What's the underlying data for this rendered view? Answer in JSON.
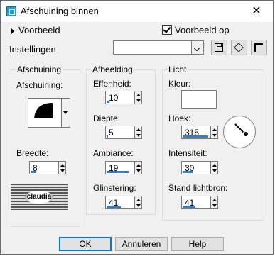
{
  "window": {
    "title": "Afschuining binnen",
    "close_glyph": "✕"
  },
  "preview": {
    "label": "Voorbeeld"
  },
  "preview_on_image": {
    "label": "Voorbeeld op afbeelding",
    "checked": true
  },
  "settings": {
    "label": "Instellingen",
    "value": ""
  },
  "toolbar": {
    "icons": [
      "save-icon",
      "randomize-icon",
      "reset-icon"
    ]
  },
  "bevel": {
    "group_title": "Afschuining",
    "shape_label": "Afschuining:",
    "width_label": "Breedte:",
    "width_value": "8",
    "logo_text": "claudia"
  },
  "image": {
    "group_title": "Afbeelding",
    "smoothness_label": "Effenheid:",
    "smoothness_value": "10",
    "depth_label": "Diepte:",
    "depth_value": "5",
    "ambience_label": "Ambiance:",
    "ambience_value": "19",
    "shininess_label": "Glinstering:",
    "shininess_value": "41"
  },
  "light": {
    "group_title": "Licht",
    "color_label": "Kleur:",
    "color_value": "#ffffff",
    "angle_label": "Hoek:",
    "angle_value": "315",
    "intensity_label": "Intensiteit:",
    "intensity_value": "30",
    "elevation_label": "Stand lichtbron:",
    "elevation_value": "41"
  },
  "buttons": {
    "ok": "OK",
    "cancel": "Annuleren",
    "help": "Help"
  },
  "colors": {
    "accent": "#0078d7",
    "slider": "#2f7bd6"
  }
}
